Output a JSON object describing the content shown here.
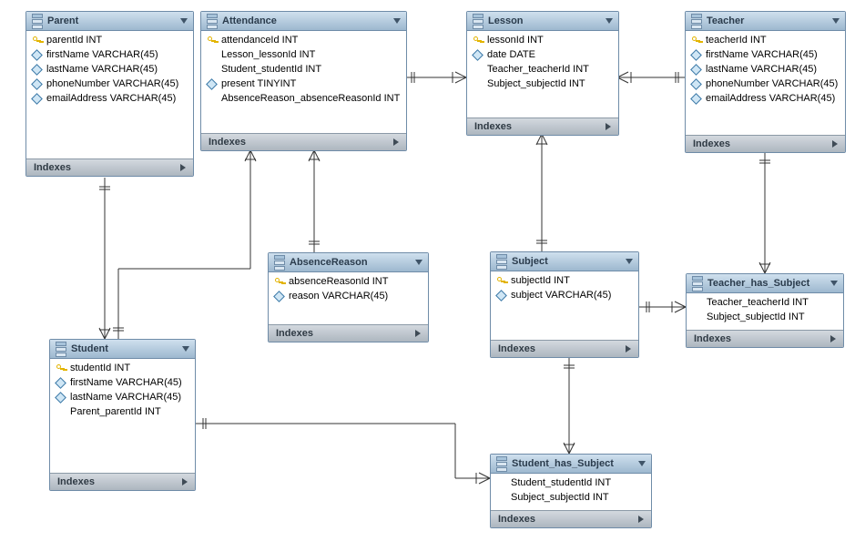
{
  "indexesLabel": "Indexes",
  "entities": {
    "parent": {
      "title": "Parent",
      "columns": [
        {
          "icon": "key",
          "name": "parentId INT"
        },
        {
          "icon": "diamond",
          "name": "firstName VARCHAR(45)"
        },
        {
          "icon": "diamond",
          "name": "lastName VARCHAR(45)"
        },
        {
          "icon": "diamond",
          "name": "phoneNumber VARCHAR(45)"
        },
        {
          "icon": "diamond",
          "name": "emailAddress VARCHAR(45)"
        }
      ]
    },
    "attendance": {
      "title": "Attendance",
      "columns": [
        {
          "icon": "key",
          "name": "attendanceId INT"
        },
        {
          "icon": "blank",
          "name": "Lesson_lessonId INT"
        },
        {
          "icon": "blank",
          "name": "Student_studentId INT"
        },
        {
          "icon": "diamond",
          "name": "present TINYINT"
        },
        {
          "icon": "blank",
          "name": "AbsenceReason_absenceReasonId INT"
        }
      ]
    },
    "lesson": {
      "title": "Lesson",
      "columns": [
        {
          "icon": "key",
          "name": "lessonId INT"
        },
        {
          "icon": "diamond",
          "name": "date DATE"
        },
        {
          "icon": "blank",
          "name": "Teacher_teacherId INT"
        },
        {
          "icon": "blank",
          "name": "Subject_subjectId INT"
        }
      ]
    },
    "teacher": {
      "title": "Teacher",
      "columns": [
        {
          "icon": "key",
          "name": "teacherId INT"
        },
        {
          "icon": "diamond",
          "name": "firstName VARCHAR(45)"
        },
        {
          "icon": "diamond",
          "name": "lastName VARCHAR(45)"
        },
        {
          "icon": "diamond",
          "name": "phoneNumber VARCHAR(45)"
        },
        {
          "icon": "diamond",
          "name": "emailAddress VARCHAR(45)"
        }
      ]
    },
    "absencereason": {
      "title": "AbsenceReason",
      "columns": [
        {
          "icon": "key",
          "name": "absenceReasonId INT"
        },
        {
          "icon": "diamond",
          "name": "reason VARCHAR(45)"
        }
      ]
    },
    "subject": {
      "title": "Subject",
      "columns": [
        {
          "icon": "key",
          "name": "subjectId INT"
        },
        {
          "icon": "diamond",
          "name": "subject VARCHAR(45)"
        }
      ]
    },
    "teacher-has-subject": {
      "title": "Teacher_has_Subject",
      "columns": [
        {
          "icon": "blank",
          "name": "Teacher_teacherId INT"
        },
        {
          "icon": "blank",
          "name": "Subject_subjectId INT"
        }
      ]
    },
    "student": {
      "title": "Student",
      "columns": [
        {
          "icon": "key",
          "name": "studentId INT"
        },
        {
          "icon": "diamond",
          "name": "firstName VARCHAR(45)"
        },
        {
          "icon": "diamond",
          "name": "lastName VARCHAR(45)"
        },
        {
          "icon": "blank",
          "name": "Parent_parentId INT"
        }
      ]
    },
    "student-has-subject": {
      "title": "Student_has_Subject",
      "columns": [
        {
          "icon": "blank",
          "name": "Student_studentId INT"
        },
        {
          "icon": "blank",
          "name": "Subject_subjectId INT"
        }
      ]
    }
  },
  "relationships": [
    {
      "from": "attendance",
      "to": "lesson"
    },
    {
      "from": "lesson",
      "to": "teacher"
    },
    {
      "from": "attendance",
      "to": "absencereason"
    },
    {
      "from": "attendance",
      "to": "student"
    },
    {
      "from": "parent",
      "to": "student"
    },
    {
      "from": "lesson",
      "to": "subject"
    },
    {
      "from": "teacher",
      "to": "teacher-has-subject"
    },
    {
      "from": "subject",
      "to": "teacher-has-subject"
    },
    {
      "from": "subject",
      "to": "student-has-subject"
    },
    {
      "from": "student",
      "to": "student-has-subject"
    }
  ]
}
